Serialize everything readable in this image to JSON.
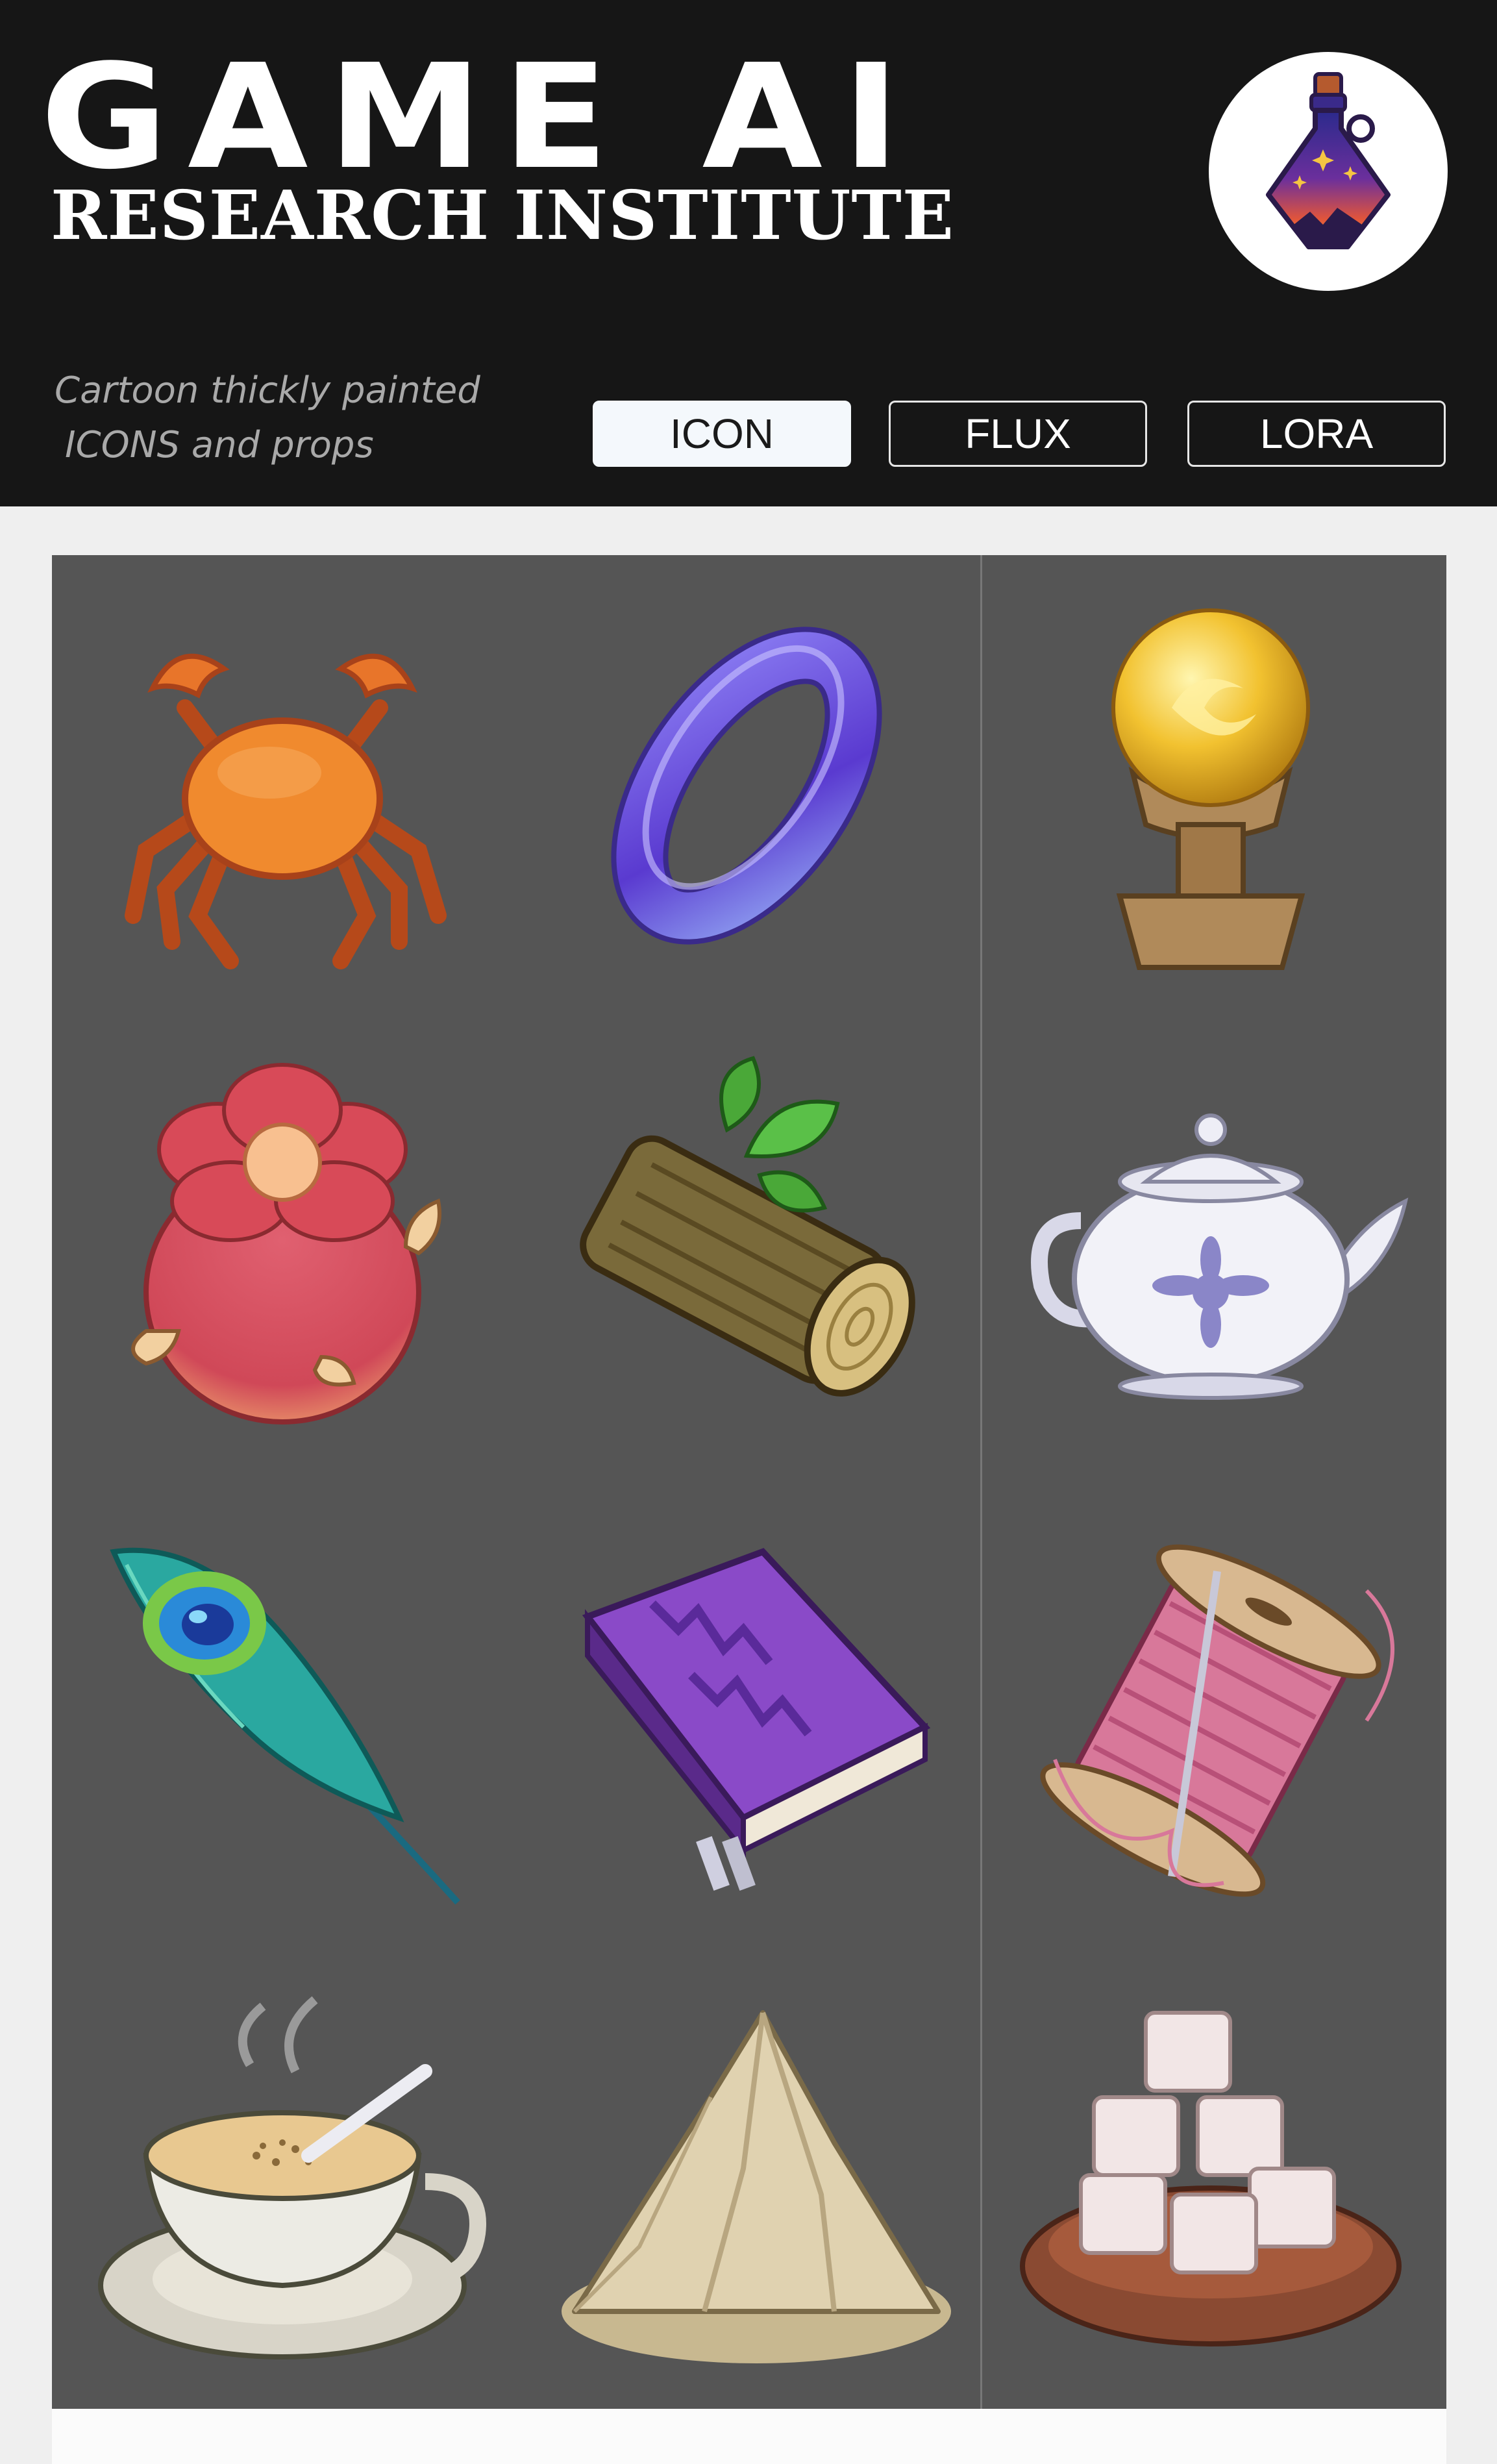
{
  "header": {
    "title": "GAME AI",
    "subtitle": "RESEARCH INSTITUTE",
    "tagline_line1": "Cartoon thickly painted",
    "tagline_line2": "ICONS and props",
    "logo_icon": "potion-bottle-icon"
  },
  "tags": [
    {
      "label": "ICON",
      "active": true
    },
    {
      "label": "FLUX",
      "active": false
    },
    {
      "label": "LORA",
      "active": false
    }
  ],
  "gallery": {
    "items": [
      {
        "icon": "crab-icon"
      },
      {
        "icon": "purple-ring-icon"
      },
      {
        "icon": "golden-orb-pedestal-icon"
      },
      {
        "icon": "flower-bulb-icon"
      },
      {
        "icon": "wood-log-icon"
      },
      {
        "icon": "porcelain-teapot-icon"
      },
      {
        "icon": "peacock-feather-icon"
      },
      {
        "icon": "purple-book-icon"
      },
      {
        "icon": "thread-spool-needle-icon"
      },
      {
        "icon": "tea-cup-icon"
      },
      {
        "icon": "powder-pile-icon"
      },
      {
        "icon": "sugar-cubes-bowl-icon"
      }
    ]
  },
  "colors": {
    "header_bg": "#161616",
    "panel_bg": "#555555",
    "page_bg": "#efefef"
  }
}
